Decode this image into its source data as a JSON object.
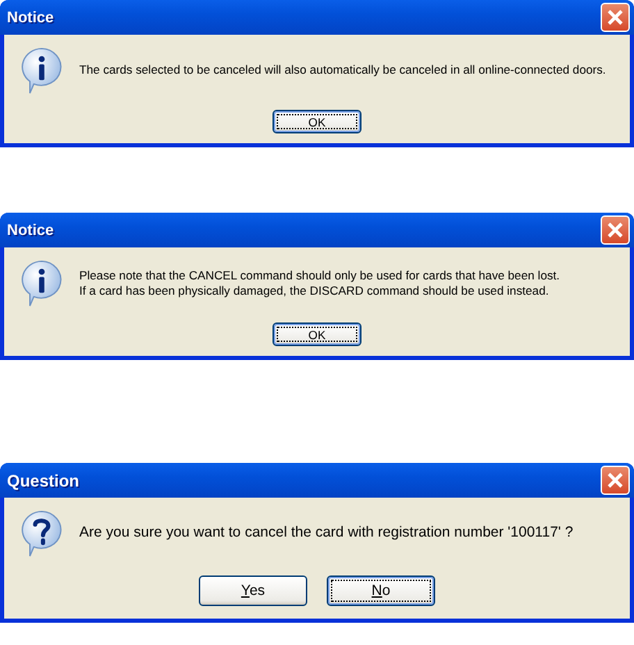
{
  "dialogs": [
    {
      "title": "Notice",
      "kind": "info",
      "message_lines": [
        "The cards selected to be canceled will also automatically be canceled in all online-connected doors."
      ],
      "buttons": [
        {
          "label": "OK",
          "focused": true
        }
      ]
    },
    {
      "title": "Notice",
      "kind": "info",
      "message_lines": [
        "Please note that the CANCEL command should only be used for cards that have been lost.",
        "If a card has been physically damaged, the DISCARD command should be used instead."
      ],
      "buttons": [
        {
          "label": "OK",
          "focused": true
        }
      ]
    },
    {
      "title": "Question",
      "kind": "question",
      "message_lines": [
        "Are you sure you want to cancel the card with registration number '100117' ?"
      ],
      "buttons": [
        {
          "label": "Yes",
          "focused": false
        },
        {
          "label": "No",
          "focused": true
        }
      ]
    }
  ]
}
